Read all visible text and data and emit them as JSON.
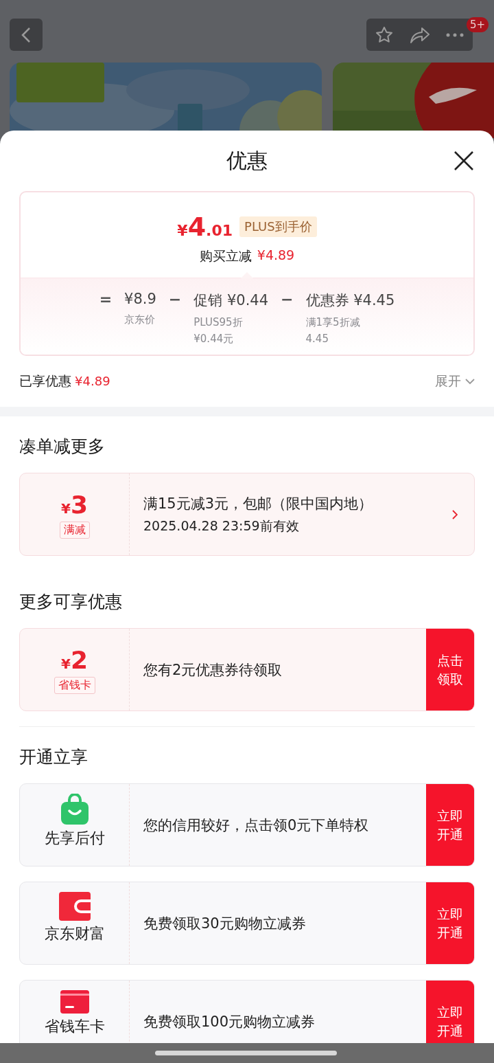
{
  "top_bar": {
    "badge": "5+"
  },
  "sheet": {
    "title": "优惠",
    "summary": {
      "price_symbol": "¥",
      "price_integer": "4",
      "price_decimal": ".01",
      "tag": "PLUS到手价",
      "saving_label": "购买立减",
      "saving_value": "¥4.89",
      "formula": [
        {
          "kind": "operator",
          "text": "="
        },
        {
          "kind": "term",
          "amount": "¥8.9",
          "note": "京东价"
        },
        {
          "kind": "operator",
          "text": "−"
        },
        {
          "kind": "term",
          "label": "促销",
          "amount": "¥0.44",
          "note": "PLUS95折 ¥0.44元"
        },
        {
          "kind": "operator",
          "text": "−"
        },
        {
          "kind": "term",
          "label": "优惠券",
          "amount": "¥4.45",
          "note": "满1享5折减4.45"
        }
      ]
    },
    "enjoyed": {
      "label": "已享优惠",
      "value": "¥4.89",
      "toggle": "展开"
    },
    "sections": [
      {
        "title": "凑单减更多",
        "divider": false,
        "cards": [
          {
            "kind": "coupon",
            "symbol": "¥",
            "amount": "3",
            "tag": "满减",
            "text": "满15元减3元，包邮（限中国内地）",
            "subtext": "2025.04.28 23:59前有效",
            "action": {
              "kind": "chevron"
            }
          }
        ]
      },
      {
        "title": "更多可享优惠",
        "divider": true,
        "cards": [
          {
            "kind": "coupon",
            "symbol": "¥",
            "amount": "2",
            "tag": "省钱卡",
            "text": "您有2元优惠券待领取",
            "action": {
              "kind": "button",
              "text": "点击领取"
            }
          }
        ]
      },
      {
        "title": "开通立享",
        "divider": false,
        "cards": [
          {
            "kind": "service",
            "label": "先享后付",
            "text": "您的信用较好，点击领0元下单特权",
            "action": {
              "kind": "button",
              "text": "立即开通"
            }
          },
          {
            "kind": "service",
            "label": "京东财富",
            "text": "免费领取30元购物立减券",
            "action": {
              "kind": "button",
              "text": "立即开通"
            }
          },
          {
            "kind": "service",
            "label": "省钱车卡",
            "text": "免费领取100元购物立减券",
            "action": {
              "kind": "button",
              "text": "立即开通"
            }
          }
        ]
      }
    ]
  }
}
